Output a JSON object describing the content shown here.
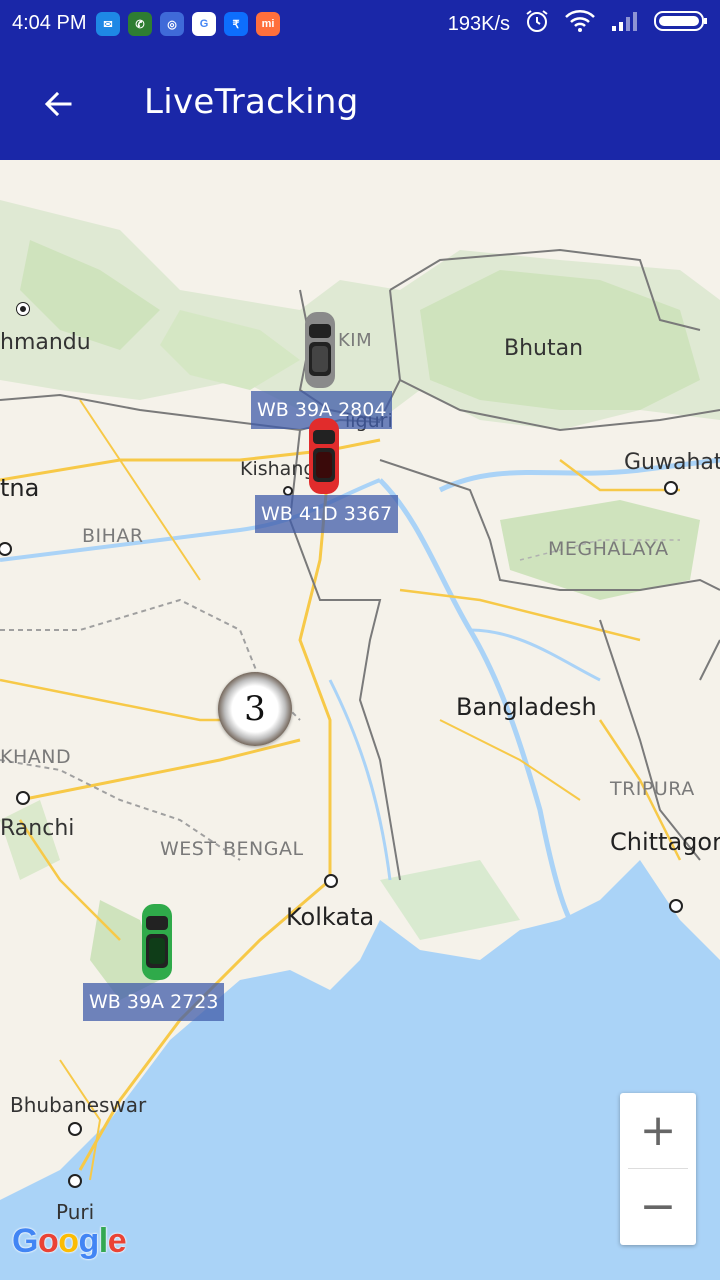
{
  "status_bar": {
    "time": "4:04 PM",
    "net_speed": "193K/s",
    "notification_icons": [
      {
        "name": "messenger-icon",
        "color": "#1e88e5",
        "glyph": "✉"
      },
      {
        "name": "whatsapp-icon",
        "color": "#2e7d32",
        "glyph": "✆"
      },
      {
        "name": "utsonmobile-icon",
        "color": "#3f6ad8",
        "glyph": "◎"
      },
      {
        "name": "google-icon",
        "color": "#ffffff",
        "glyph": "G"
      },
      {
        "name": "paytm-icon",
        "color": "#0d6efd",
        "glyph": "₹"
      },
      {
        "name": "mi-icon",
        "color": "#ff6f3c",
        "glyph": "mi"
      }
    ]
  },
  "app_bar": {
    "title": "LiveTracking",
    "background": "#1a27a8"
  },
  "map": {
    "place_labels": {
      "kathmandu": "hmandu",
      "sikkim": "KIM",
      "bhutan": "Bhutan",
      "siliguri": "liguri",
      "kishanganj": "Kishange",
      "guwahati": "Guwahati",
      "patna": "tna",
      "bihar": "BIHAR",
      "meghalaya": "MEGHALAYA",
      "bangladesh": "Bangladesh",
      "jharkhand": "KHAND",
      "tripura": "TRIPURA",
      "ranchi": "Ranchi",
      "west_bengal": "WEST BENGAL",
      "chittagong": "Chittagor",
      "kolkata": "Kolkata",
      "bhubaneswar": "Bhubaneswar",
      "puri": "Puri"
    },
    "vehicles": [
      {
        "plate": "WB 39A 2804",
        "color": "#8a8a8a"
      },
      {
        "plate": "WB 41D 3367",
        "color": "#e12c2c"
      },
      {
        "plate": "WB  39A 2723",
        "color": "#2faa4a"
      }
    ],
    "cluster_count": "3",
    "zoom_in_label": "+",
    "zoom_out_label": "−",
    "attribution": [
      "G",
      "o",
      "o",
      "g",
      "l",
      "e"
    ],
    "attribution_colors": [
      "#4285f4",
      "#ea4335",
      "#fbbc05",
      "#4285f4",
      "#34a853",
      "#ea4335"
    ],
    "colors": {
      "land": "#f5f2ea",
      "water": "#aad3f7",
      "forest": "#c8e3b4",
      "road": "#f7c948"
    }
  }
}
